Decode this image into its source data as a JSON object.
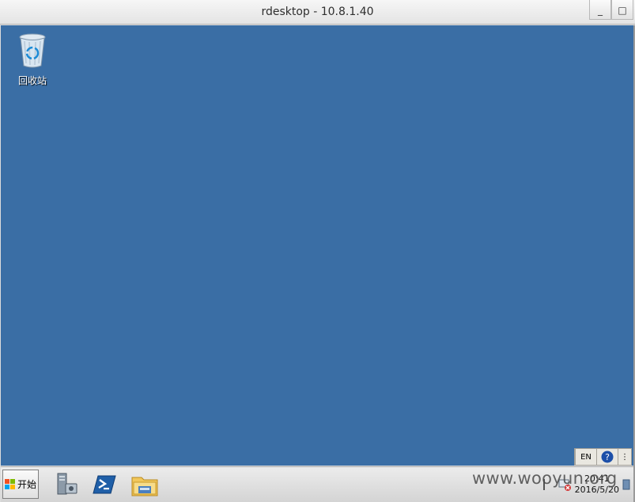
{
  "window": {
    "title": "rdesktop - 10.8.1.40",
    "minimize_glyph": "_",
    "maximize_glyph": "□"
  },
  "desktop": {
    "background_color": "#3a6ea5",
    "icons": [
      {
        "label": "回收站",
        "icon": "recycle-bin-icon"
      }
    ]
  },
  "language_bar": {
    "language": "EN",
    "help_icon": "help-icon",
    "options_glyph": "⋮"
  },
  "taskbar": {
    "start_label": "开始",
    "pinned": [
      {
        "name": "server-manager-icon"
      },
      {
        "name": "powershell-icon"
      },
      {
        "name": "file-explorer-icon"
      }
    ],
    "clock": {
      "time": "20:41",
      "date": "2016/5/20"
    }
  },
  "watermark": "www.wooyun.org"
}
